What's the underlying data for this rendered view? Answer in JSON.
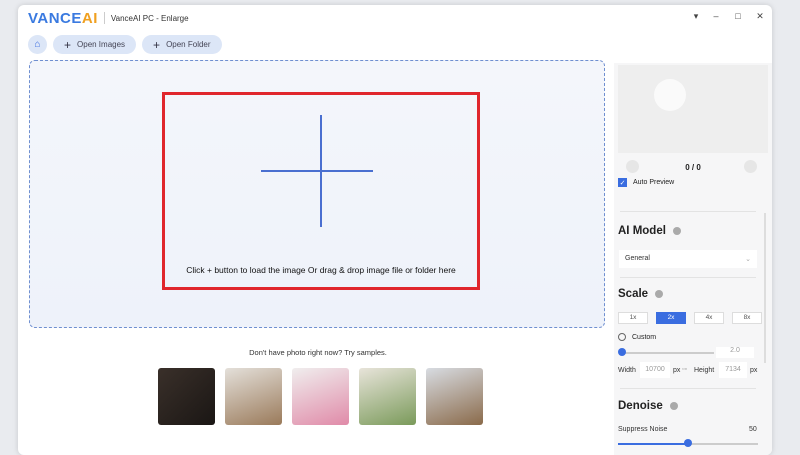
{
  "window": {
    "logo": "VANCEAI",
    "title": "VanceAI PC - Enlarge",
    "controls": [
      "▾",
      "–",
      "□",
      "✕"
    ]
  },
  "toolbar": {
    "open_images": "Open Images",
    "open_folder": "Open Folder"
  },
  "dropzone": {
    "hint": "Click + button to load the image Or drag & drop image file or folder here"
  },
  "samples": {
    "prompt": "Don't have photo right now? Try samples.",
    "thumbs": [
      "#2a2420",
      "#b9a88f",
      "#e9b7b9",
      "#d5c7a8",
      "#b8aea4"
    ]
  },
  "panel": {
    "pager": "0 / 0",
    "auto_preview": "Auto Preview",
    "ai_model": {
      "title": "AI Model",
      "selected": "General"
    },
    "scale": {
      "title": "Scale",
      "options": [
        "1x",
        "2x",
        "4x",
        "8x"
      ],
      "selected": "2x",
      "custom": "Custom",
      "custom_value": "2.0",
      "width_label": "Width",
      "width": "10700",
      "px": "px",
      "height_label": "Height",
      "height": "7134"
    },
    "denoise": {
      "title": "Denoise",
      "suppress_label": "Suppress Noise",
      "suppress_value": "50",
      "suppress_level": 50
    }
  },
  "colors": {
    "accent": "#3a6de0",
    "highlight": "#e0262c"
  }
}
